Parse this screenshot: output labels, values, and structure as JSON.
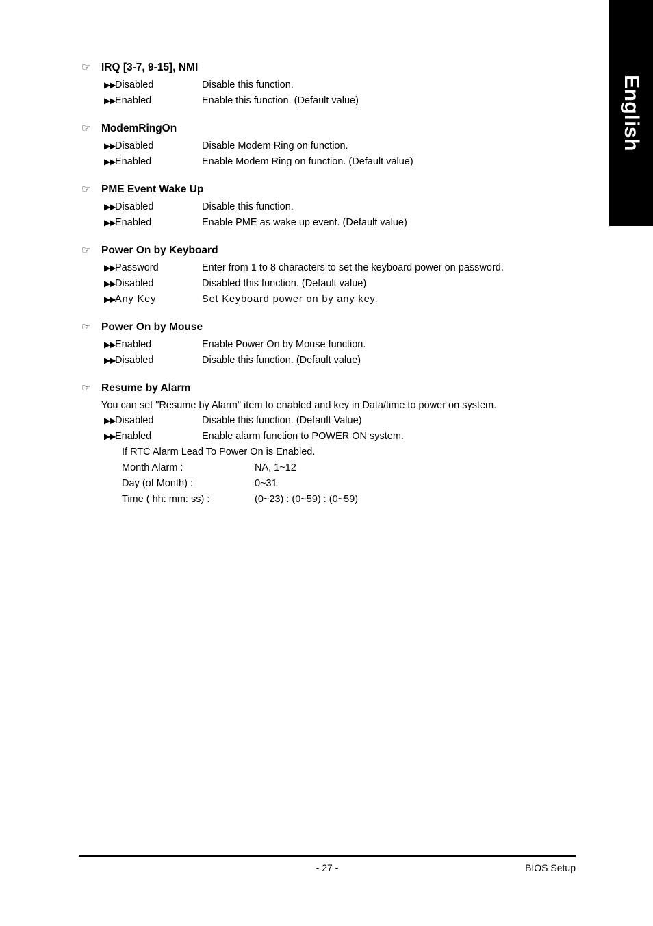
{
  "language_tab": {
    "label": "English"
  },
  "icons": {
    "heading_bullet": "hand-pointing-icon",
    "heading_bullet_glyph": "☞",
    "option_bullet": "double-arrow-right-icon",
    "option_bullet_glyph": "▶▶"
  },
  "sections": [
    {
      "title": "IRQ [3-7, 9-15], NMI",
      "note": null,
      "options": [
        {
          "label": "Disabled",
          "description": "Disable this function."
        },
        {
          "label": "Enabled",
          "description": "Enable this function. (Default value)"
        }
      ]
    },
    {
      "title": "ModemRingOn",
      "note": null,
      "options": [
        {
          "label": "Disabled",
          "description": "Disable Modem Ring on function."
        },
        {
          "label": "Enabled",
          "description": "Enable Modem Ring on function. (Default value)"
        }
      ]
    },
    {
      "title": "PME Event Wake Up",
      "note": null,
      "options": [
        {
          "label": "Disabled",
          "description": "Disable this function."
        },
        {
          "label": "Enabled",
          "description": "Enable PME as wake up event. (Default value)"
        }
      ]
    },
    {
      "title": "Power On by Keyboard",
      "note": null,
      "options": [
        {
          "label": "Password",
          "description": "Enter from 1 to 8 characters to set the keyboard power on password."
        },
        {
          "label": "Disabled",
          "description": "Disabled this function. (Default value)"
        },
        {
          "label": "Any Key",
          "description": "Set Keyboard power on by any key.",
          "wide_tracking": true
        }
      ]
    },
    {
      "title": "Power On by Mouse",
      "note": null,
      "options": [
        {
          "label": "Enabled",
          "description": "Enable Power On by Mouse function."
        },
        {
          "label": "Disabled",
          "description": "Disable this function. (Default value)"
        }
      ]
    },
    {
      "title": "Resume by Alarm",
      "note": "You can set \"Resume by Alarm\" item to enabled and key in Data/time to power on system.",
      "options": [
        {
          "label": "Disabled",
          "description": "Disable this function. (Default Value)"
        },
        {
          "label": "Enabled",
          "description": "Enable alarm function to POWER ON system."
        }
      ],
      "details": {
        "intro": "If RTC Alarm Lead To Power On is Enabled.",
        "rows": [
          {
            "key": "Month Alarm :",
            "value": "NA, 1~12"
          },
          {
            "key": "Day (of Month) :",
            "value": "0~31"
          },
          {
            "key": "Time ( hh: mm: ss) :",
            "value": "(0~23) : (0~59) : (0~59)"
          }
        ]
      }
    }
  ],
  "footer": {
    "page_number": "- 27 -",
    "right_label": "BIOS Setup"
  }
}
